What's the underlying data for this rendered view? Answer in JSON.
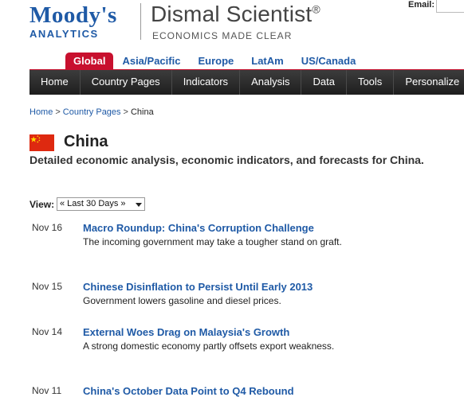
{
  "header": {
    "logo_top": "Moody's",
    "logo_bottom": "ANALYTICS",
    "site_title": "Dismal Scientist",
    "registered": "®",
    "tagline": "ECONOMICS MADE CLEAR",
    "email_label": "Email:",
    "email_value": ""
  },
  "region_tabs": [
    {
      "label": "Global",
      "active": true
    },
    {
      "label": "Asia/Pacific"
    },
    {
      "label": "Europe"
    },
    {
      "label": "LatAm"
    },
    {
      "label": "US/Canada"
    }
  ],
  "nav": [
    "Home",
    "Country Pages",
    "Indicators",
    "Analysis",
    "Data",
    "Tools",
    "Personalize"
  ],
  "breadcrumb": {
    "home": "Home",
    "country_pages": "Country Pages",
    "current": "China",
    "separator": ">"
  },
  "page": {
    "title": "China",
    "subtitle": "Detailed economic analysis, economic indicators, and forecasts for China.",
    "flag_icon": "china-flag-icon"
  },
  "view": {
    "label": "View:",
    "selected": "« Last 30 Days »"
  },
  "articles": [
    {
      "date": "Nov 16",
      "headline": "Macro Roundup: China's Corruption Challenge",
      "summary": "The incoming government may take a tougher stand on graft."
    },
    {
      "date": "Nov 15",
      "headline": "Chinese Disinflation to Persist Until Early 2013",
      "summary": "Government lowers gasoline and diesel prices."
    },
    {
      "date": "Nov 14",
      "headline": "External Woes Drag on Malaysia's Growth",
      "summary": "A strong domestic economy partly offsets export weakness."
    },
    {
      "date": "Nov 11",
      "headline": "China's October Data Point to Q4 Rebound",
      "summary": ""
    }
  ],
  "colors": {
    "brand_blue": "#1f5aa6",
    "active_tab_red": "#c8102e",
    "nav_dark": "#2b2b2b"
  }
}
